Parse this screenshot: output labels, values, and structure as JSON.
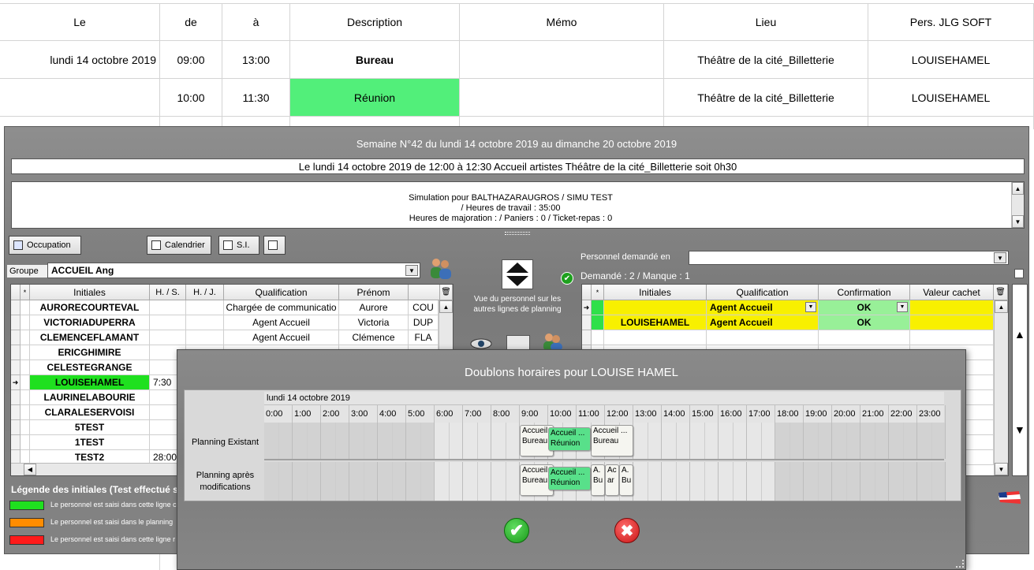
{
  "background_table": {
    "headers": [
      "Le",
      "de",
      "à",
      "Description",
      "Mémo",
      "Lieu",
      "Pers. JLG SOFT"
    ],
    "rows": [
      [
        "lundi 14 octobre 2019",
        "09:00",
        "13:00",
        "Bureau",
        "",
        "Théâtre de la cité_Billetterie",
        "LOUISEHAMEL"
      ],
      [
        "",
        "10:00",
        "11:30",
        "Réunion",
        "",
        "Théâtre de la cité_Billetterie",
        "LOUISEHAMEL"
      ]
    ]
  },
  "panel": {
    "week_title": "Semaine N°42 du lundi 14 octobre 2019 au dimanche 20 octobre 2019",
    "slot_info": "Le lundi 14 octobre 2019  de  12:00  à  12:30  Accueil artistes  Théâtre de la cité_Billetterie  soit 0h30",
    "simulation": {
      "line1": "Simulation pour BALTHAZARAUGROS / SIMU TEST",
      "line2": "/ Heures de travail : 35:00",
      "line3": "Heures de majoration :  / Paniers : 0 / Ticket-repas : 0"
    },
    "checkboxes": {
      "occupation": "Occupation",
      "calendrier": "Calendrier",
      "si": "S.I."
    },
    "group_label": "Groupe",
    "group_value": "ACCUEIL Ang",
    "personnel_demande_label": "Personnel demandé en",
    "demande_text": "Demandé : 2 / Manque : 1",
    "vue_text": "Vue du personnel sur les autres lignes de planning",
    "left_table": {
      "headers": [
        "*",
        "Initiales",
        "H. / S.",
        "H. / J.",
        "Qualification",
        "Prénom"
      ],
      "rows": [
        {
          "initiales": "AURORECOURTEVAL",
          "hs": "",
          "qualif": "Chargée de communicatio",
          "prenom": "Aurore",
          "extra": "COU"
        },
        {
          "initiales": "VICTORIADUPERRA",
          "hs": "",
          "qualif": "Agent Accueil",
          "prenom": "Victoria",
          "extra": "DUP"
        },
        {
          "initiales": "CLEMENCEFLAMANT",
          "hs": "",
          "qualif": "Agent Accueil",
          "prenom": "Clémence",
          "extra": "FLA"
        },
        {
          "initiales": "ERICGHIMIRE",
          "hs": "",
          "qualif": "",
          "prenom": "",
          "extra": ""
        },
        {
          "initiales": "CELESTEGRANGE",
          "hs": "",
          "qualif": "",
          "prenom": "",
          "extra": ""
        },
        {
          "initiales": "LOUISEHAMEL",
          "hs": "7:30",
          "qualif": "",
          "prenom": "",
          "extra": ""
        },
        {
          "initiales": "LAURINELABOURIE",
          "hs": "",
          "qualif": "",
          "prenom": "",
          "extra": ""
        },
        {
          "initiales": "CLARALESERVOISI",
          "hs": "",
          "qualif": "",
          "prenom": "",
          "extra": ""
        },
        {
          "initiales": "5TEST",
          "hs": "",
          "qualif": "",
          "prenom": "",
          "extra": ""
        },
        {
          "initiales": "1TEST",
          "hs": "",
          "qualif": "",
          "prenom": "",
          "extra": ""
        },
        {
          "initiales": "TEST2",
          "hs": "28:00",
          "qualif": "",
          "prenom": "",
          "extra": ""
        }
      ]
    },
    "right_table": {
      "headers": [
        "*",
        "Initiales",
        "Qualification",
        "Confirmation",
        "Valeur cachet"
      ],
      "rows": [
        {
          "initiales": "",
          "qualif": "Agent Accueil",
          "confirmation": "OK"
        },
        {
          "initiales": "LOUISEHAMEL",
          "qualif": "Agent Accueil",
          "confirmation": "OK"
        }
      ]
    },
    "legend": {
      "title": "Légende des initiales (Test effectué s",
      "items": [
        {
          "color": "#1fe01f",
          "text": "Le personnel est saisi dans cette ligne c"
        },
        {
          "color": "#ff8c00",
          "text": "Le personnel est saisi dans le planning"
        },
        {
          "color": "#ff1a1a",
          "text": "Le personnel est saisi dans cette ligne r"
        }
      ]
    }
  },
  "modal": {
    "title": "Doublons horaires pour LOUISE HAMEL",
    "date_label": "lundi 14 octobre 2019",
    "hours": [
      "0:00",
      "1:00",
      "2:00",
      "3:00",
      "4:00",
      "5:00",
      "6:00",
      "7:00",
      "8:00",
      "9:00",
      "10:00",
      "11:00",
      "12:00",
      "13:00",
      "14:00",
      "15:00",
      "16:00",
      "17:00",
      "18:00",
      "19:00",
      "20:00",
      "21:00",
      "22:00",
      "23:00"
    ],
    "row1_label": "Planning Existant",
    "row2_label": "Planning après modifications",
    "events_existing": [
      {
        "l1": "Accueil",
        "l2": "Bureau",
        "start": 9.0,
        "end": 10.2,
        "color": "#f5f5f0"
      },
      {
        "l1": "Accueil ...",
        "l2": "Réunion",
        "start": 10.0,
        "end": 11.5,
        "color": "#58e08a"
      },
      {
        "l1": "Accueil ...",
        "l2": "Bureau",
        "start": 11.5,
        "end": 13.0,
        "color": "#f5f5f0"
      }
    ],
    "events_after": [
      {
        "l1": "Accueil",
        "l2": "Bureau",
        "start": 9.0,
        "end": 10.2,
        "color": "#f5f5f0"
      },
      {
        "l1": "Accueil ...",
        "l2": "Réunion",
        "start": 10.0,
        "end": 11.5,
        "color": "#58e08a"
      },
      {
        "l1": "A.",
        "l2": "Bu",
        "start": 11.5,
        "end": 12.0,
        "color": "#f5f5f0"
      },
      {
        "l1": "Ac",
        "l2": "ar",
        "start": 12.0,
        "end": 12.5,
        "color": "#f5f5f0"
      },
      {
        "l1": "A.",
        "l2": "Bu",
        "start": 12.5,
        "end": 13.0,
        "color": "#f5f5f0"
      }
    ],
    "confirm_icon": "check-icon",
    "cancel_icon": "close-icon"
  }
}
